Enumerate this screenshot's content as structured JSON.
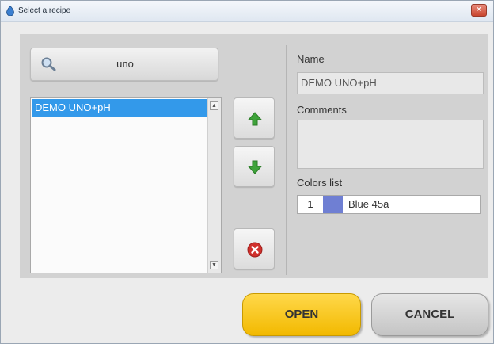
{
  "window": {
    "title": "Select a recipe",
    "close_label": "✕"
  },
  "search": {
    "value": "uno"
  },
  "recipe_list": {
    "items": [
      {
        "label": "DEMO UNO+pH",
        "selected": true
      }
    ],
    "scroll_up": "▲",
    "scroll_down": "▼"
  },
  "details": {
    "name_label": "Name",
    "name_value": "DEMO UNO+pH",
    "comments_label": "Comments",
    "comments_value": "",
    "colors_label": "Colors list",
    "colors": [
      {
        "index": "1",
        "name": "Blue 45a",
        "swatch": "#6f7fd3"
      }
    ]
  },
  "actions": {
    "open_label": "OPEN",
    "cancel_label": "CANCEL"
  },
  "theme": {
    "selection": "#3399ea",
    "open_button": "#f5c000",
    "arrow_green": "#3ea33a",
    "delete_red": "#d0302c"
  },
  "icons": {
    "app": "app-icon",
    "search": "search-icon",
    "move_up": "arrow-up-icon",
    "move_down": "arrow-down-icon",
    "delete": "delete-icon"
  }
}
